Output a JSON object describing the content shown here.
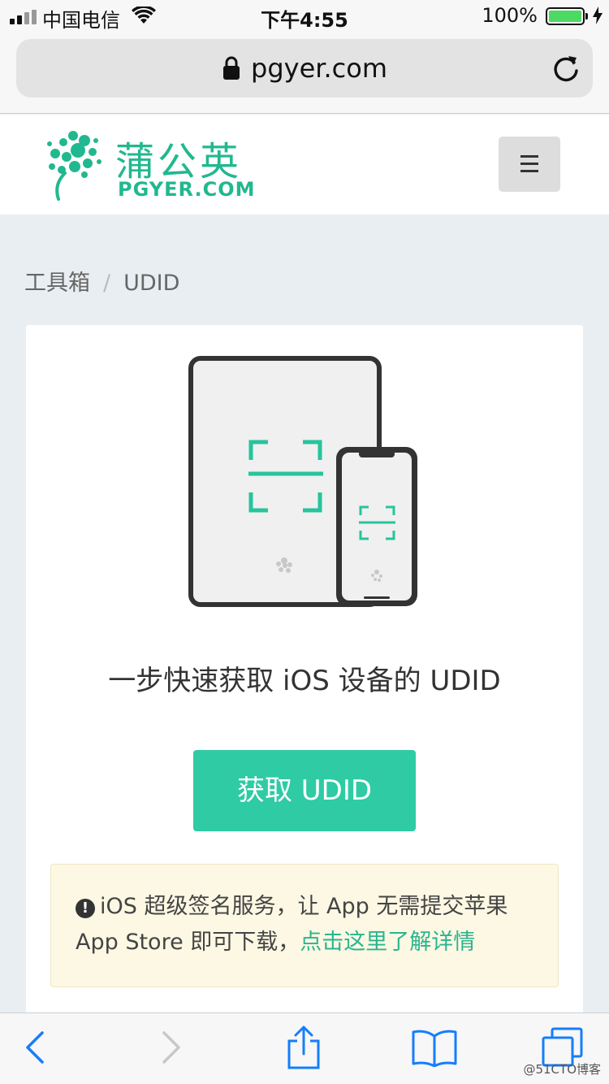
{
  "status_bar": {
    "carrier": "中国电信",
    "time": "下午4:55",
    "battery": "100%"
  },
  "browser": {
    "url": "pgyer.com"
  },
  "site_header": {
    "logo_cn": "蒲公英",
    "logo_en": "PGYER.COM"
  },
  "breadcrumb": {
    "root": "工具箱",
    "separator": "/",
    "current": "UDID"
  },
  "card": {
    "headline": "一步快速获取 iOS 设备的 UDID",
    "button_label": "获取 UDID",
    "notice_text": "iOS 超级签名服务，让 App 无需提交苹果 App Store 即可下载，",
    "notice_link": "点击这里了解详情"
  },
  "colors": {
    "brand": "#22b88f",
    "button": "#2ecba4",
    "notice_bg": "#fcf8e3",
    "ios_link": "#157efb"
  },
  "toolbar": {
    "icons": [
      "back-icon",
      "forward-icon",
      "share-icon",
      "bookmarks-icon",
      "tabs-icon"
    ]
  },
  "watermark": "@51CTO博客"
}
